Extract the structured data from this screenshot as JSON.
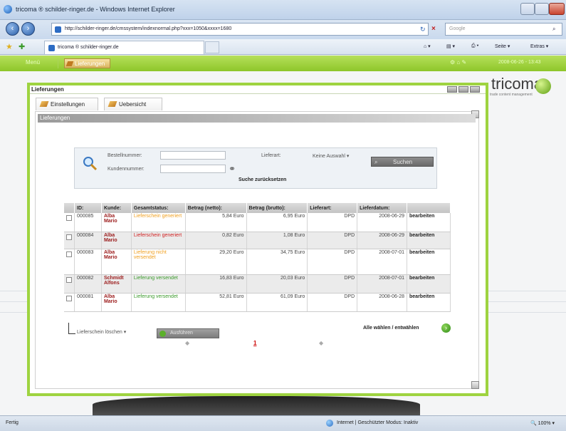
{
  "browser": {
    "window_title": "tricoma ® schilder-ringer.de - Windows Internet Explorer",
    "address": "http://schilder-ringer.de/cmssystem/indexnormal.php?xxx=1050&xxxx=1680",
    "search_placeholder": "Google",
    "tab_title": "tricoma ® schilder-ringer.de",
    "tools": [
      "Seite",
      "Extras"
    ],
    "status_left": "Fertig",
    "status_zone": "Internet | Geschützter Modus: Inaktiv",
    "zoom": "100%"
  },
  "app": {
    "menu_label": "Menü",
    "module_button": "Lieferungen",
    "brand": "tricoma",
    "brand_sub": "trade content management",
    "topright_date": "2008-06-26 - 13:43"
  },
  "popup": {
    "title": "Lieferungen",
    "tabs": [
      "Einstellungen",
      "Uebersicht"
    ],
    "section_title": "Lieferungen",
    "search": {
      "bestellnummer_label": "Bestellnummer:",
      "kundennummer_label": "Kundennummer:",
      "lieferart_label": "Lieferart:",
      "lieferart_value": "Keine Auswahl",
      "search_button": "Suchen",
      "reset_label": "Suche zurücksetzen"
    },
    "table": {
      "headers": [
        "ID:",
        "Kunde:",
        "Gesamtstatus:",
        "Betrag (netto):",
        "Betrag (brutto):",
        "Lieferart:",
        "Lieferdatum:",
        ""
      ],
      "rows": [
        {
          "id": "000085",
          "kunde": "Alba Mario",
          "status": "Lieferschein generiert",
          "netto": "5,84 Euro",
          "brutto": "6,95 Euro",
          "lieferart": "DPD",
          "datum": "2008-06-29",
          "action": "bearbeiten",
          "status_color": "orange"
        },
        {
          "id": "000084",
          "kunde": "Alba Mario",
          "status": "Lieferschein generiert",
          "netto": "0,82 Euro",
          "brutto": "1,08 Euro",
          "lieferart": "DPD",
          "datum": "2008-06-29",
          "action": "bearbeiten",
          "status_color": "red"
        },
        {
          "id": "000083",
          "kunde": "Alba Mario",
          "status": "Lieferung nicht versendet",
          "netto": "29,20 Euro",
          "brutto": "34,75 Euro",
          "lieferart": "DPD",
          "datum": "2008-07-01",
          "action": "bearbeiten",
          "status_color": "orange"
        },
        {
          "id": "000082",
          "kunde": "Schmidt Alfons",
          "status": "Lieferung versendet",
          "netto": "16,83 Euro",
          "brutto": "20,03 Euro",
          "lieferart": "DPD",
          "datum": "2008-07-01",
          "action": "bearbeiten",
          "status_color": "green"
        },
        {
          "id": "000081",
          "kunde": "Alba Mario",
          "status": "Lieferung versendet",
          "netto": "52,81 Euro",
          "brutto": "61,09 Euro",
          "lieferart": "DPD",
          "datum": "2008-06-28",
          "action": "bearbeiten",
          "status_color": "green"
        }
      ]
    },
    "bulk_action_value": "Lieferschein löschen",
    "execute_button": "Ausführen",
    "select_all": "Alle wählen / entwählen",
    "pagination": {
      "current": "1"
    }
  },
  "colors": {
    "accent_green": "#9ed340",
    "orange": "#f0a020",
    "red": "#d02020",
    "green": "#3a9a2a"
  }
}
